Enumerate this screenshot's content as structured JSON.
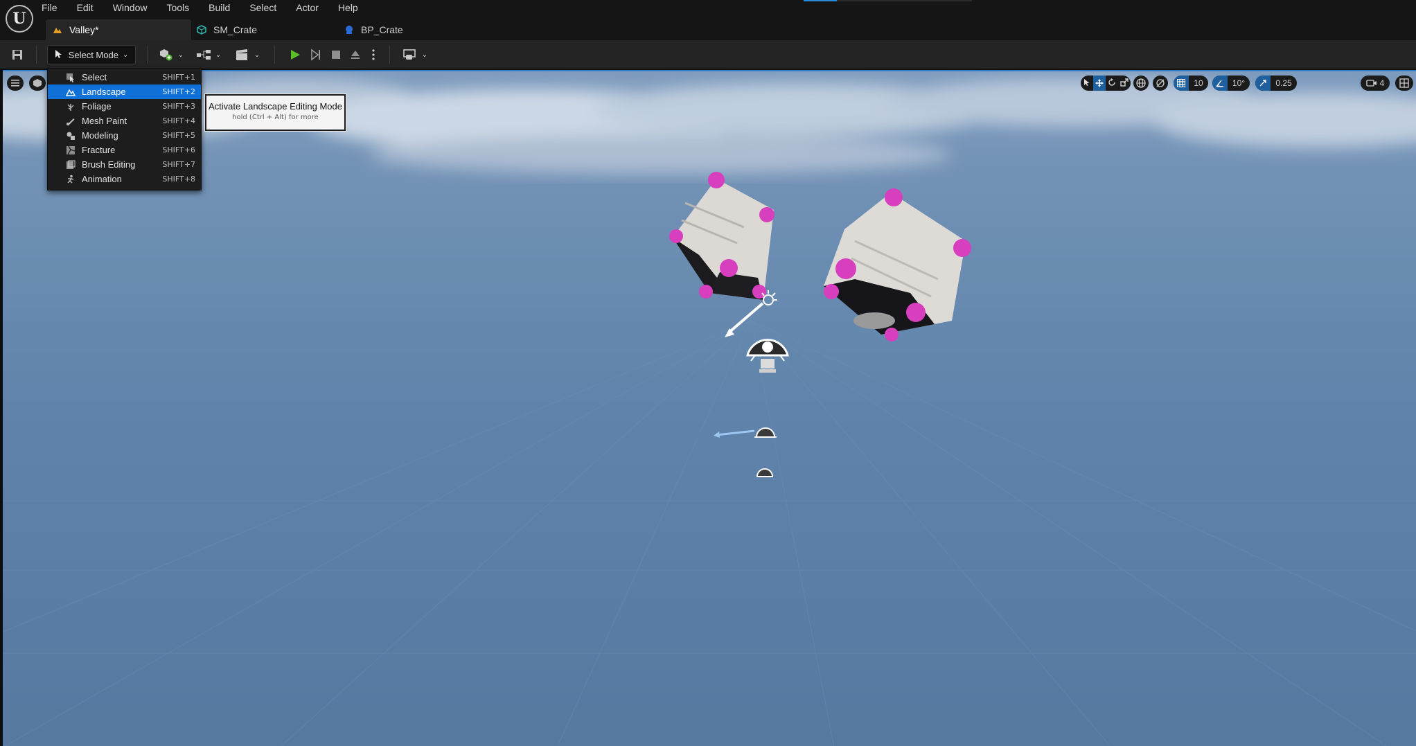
{
  "menu": {
    "items": [
      "File",
      "Edit",
      "Window",
      "Tools",
      "Build",
      "Select",
      "Actor",
      "Help"
    ]
  },
  "tabs": [
    {
      "label": "Valley*",
      "icon": "level-icon",
      "active": true
    },
    {
      "label": "SM_Crate",
      "icon": "static-mesh-icon"
    },
    {
      "label": "BP_Crate",
      "icon": "blueprint-icon"
    }
  ],
  "toolbar": {
    "mode_label": "Select Mode"
  },
  "mode_menu": {
    "items": [
      {
        "label": "Select",
        "shortcut": "SHIFT+1",
        "icon": "select-icon"
      },
      {
        "label": "Landscape",
        "shortcut": "SHIFT+2",
        "icon": "landscape-icon",
        "highlighted": true
      },
      {
        "label": "Foliage",
        "shortcut": "SHIFT+3",
        "icon": "foliage-icon"
      },
      {
        "label": "Mesh Paint",
        "shortcut": "SHIFT+4",
        "icon": "mesh-paint-icon"
      },
      {
        "label": "Modeling",
        "shortcut": "SHIFT+5",
        "icon": "modeling-icon"
      },
      {
        "label": "Fracture",
        "shortcut": "SHIFT+6",
        "icon": "fracture-icon"
      },
      {
        "label": "Brush Editing",
        "shortcut": "SHIFT+7",
        "icon": "brush-editing-icon"
      },
      {
        "label": "Animation",
        "shortcut": "SHIFT+8",
        "icon": "animation-icon"
      }
    ]
  },
  "tooltip": {
    "title": "Activate Landscape Editing Mode",
    "hint": "hold (Ctrl + Alt) for more"
  },
  "viewport_toolbar": {
    "grid_snap": "10",
    "rotation_snap": "10°",
    "scale_snap": "0.25",
    "camera_speed": "4"
  },
  "colors": {
    "accent": "#0f70d7",
    "highlight_row": "#0f70d7",
    "active_toggle": "#1f5f9e",
    "play_green": "#5cbf2a"
  }
}
